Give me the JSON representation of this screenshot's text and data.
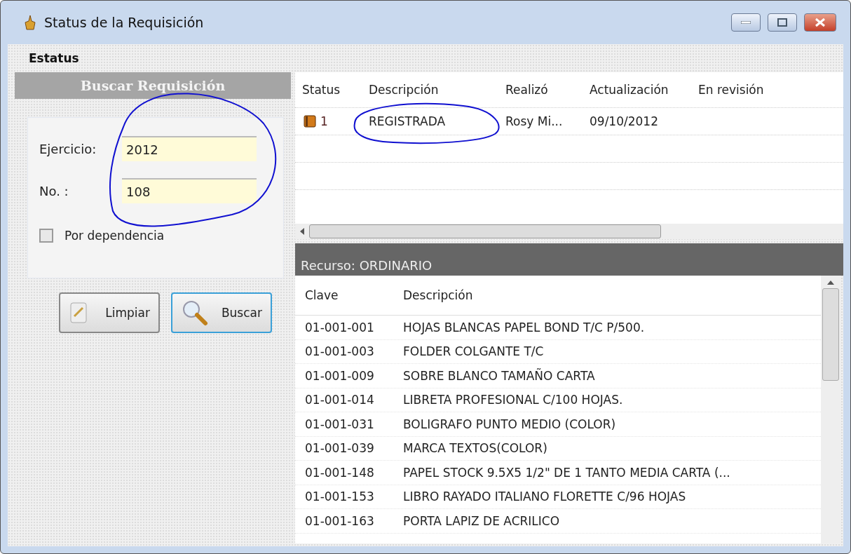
{
  "window": {
    "title": "Status de la Requisición"
  },
  "menu": [
    {
      "label": "Estatus"
    }
  ],
  "search_panel": {
    "title": "Buscar Requisición",
    "fields": [
      {
        "label": "Ejercicio:",
        "value": "2012"
      },
      {
        "label": "No. :",
        "value": "108"
      }
    ],
    "checkbox": {
      "label": "Por dependencia",
      "checked": false
    },
    "buttons": [
      {
        "label": "Limpiar",
        "kind": "clear",
        "focused": false
      },
      {
        "label": "Buscar",
        "kind": "search",
        "focused": true
      }
    ]
  },
  "status_table": {
    "columns": [
      "Status",
      "Descripción",
      "Realizó",
      "Actualización",
      "En revisión"
    ],
    "rows": [
      {
        "status": "1",
        "descripcion": "REGISTRADA",
        "realizo": "Rosy Mi...",
        "actualizacion": "09/10/2012",
        "en_revision": ""
      }
    ]
  },
  "resource_bar": {
    "label": "Recurso: ORDINARIO"
  },
  "items_table": {
    "columns": [
      "Clave",
      "Descripción"
    ],
    "rows": [
      {
        "clave": "01-001-001",
        "descripcion": "HOJAS BLANCAS PAPEL BOND T/C P/500."
      },
      {
        "clave": "01-001-003",
        "descripcion": "FOLDER COLGANTE T/C"
      },
      {
        "clave": "01-001-009",
        "descripcion": "SOBRE BLANCO TAMAÑO CARTA"
      },
      {
        "clave": "01-001-014",
        "descripcion": "LIBRETA PROFESIONAL C/100 HOJAS."
      },
      {
        "clave": "01-001-031",
        "descripcion": "BOLIGRAFO PUNTO MEDIO (COLOR)"
      },
      {
        "clave": "01-001-039",
        "descripcion": "MARCA TEXTOS(COLOR)"
      },
      {
        "clave": "01-001-148",
        "descripcion": "PAPEL STOCK 9.5X5 1/2\" DE 1 TANTO MEDIA CARTA (..."
      },
      {
        "clave": "01-001-153",
        "descripcion": "LIBRO RAYADO ITALIANO FLORETTE C/96 HOJAS"
      },
      {
        "clave": "01-001-163",
        "descripcion": "PORTA LAPIZ DE ACRILICO"
      }
    ]
  }
}
